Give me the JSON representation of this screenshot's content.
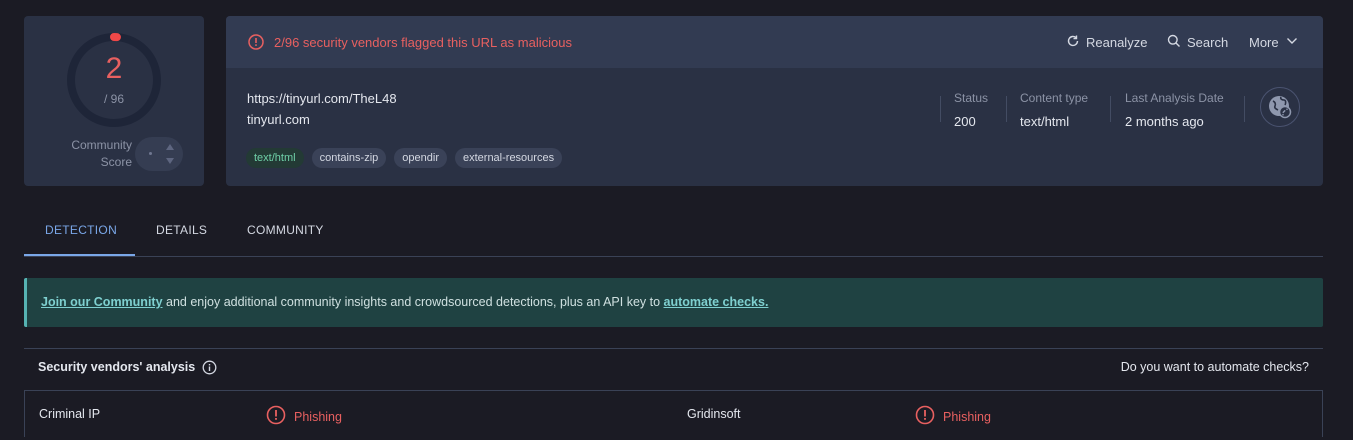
{
  "score": {
    "detections": "2",
    "total": "/ 96",
    "ratio": 0.0208,
    "community_label_1": "Community",
    "community_label_2": "Score"
  },
  "header": {
    "alert": "2/96 security vendors flagged this URL as malicious",
    "reanalyze": "Reanalyze",
    "search": "Search",
    "more": "More"
  },
  "url": {
    "full": "https://tinyurl.com/TheL48",
    "host": "tinyurl.com",
    "tags": [
      "text/html",
      "contains-zip",
      "opendir",
      "external-resources"
    ]
  },
  "meta": {
    "status_label": "Status",
    "status_value": "200",
    "content_type_label": "Content type",
    "content_type_value": "text/html",
    "last_analysis_label": "Last Analysis Date",
    "last_analysis_value": "2 months ago"
  },
  "tabs": [
    "DETECTION",
    "DETAILS",
    "COMMUNITY"
  ],
  "banner": {
    "link1": "Join our Community",
    "text": " and enjoy additional community insights and crowdsourced detections, plus an API key to ",
    "link2": "automate checks."
  },
  "vendors": {
    "title": "Security vendors' analysis",
    "automate": "Do you want to automate checks?",
    "rows": [
      {
        "left_name": "Criminal IP",
        "left_result": "Phishing",
        "right_name": "Gridinsoft",
        "right_result": "Phishing"
      }
    ]
  },
  "colors": {
    "malicious": "#e86060",
    "accent": "#7aa7e8",
    "banner_bg": "#1f4242"
  }
}
